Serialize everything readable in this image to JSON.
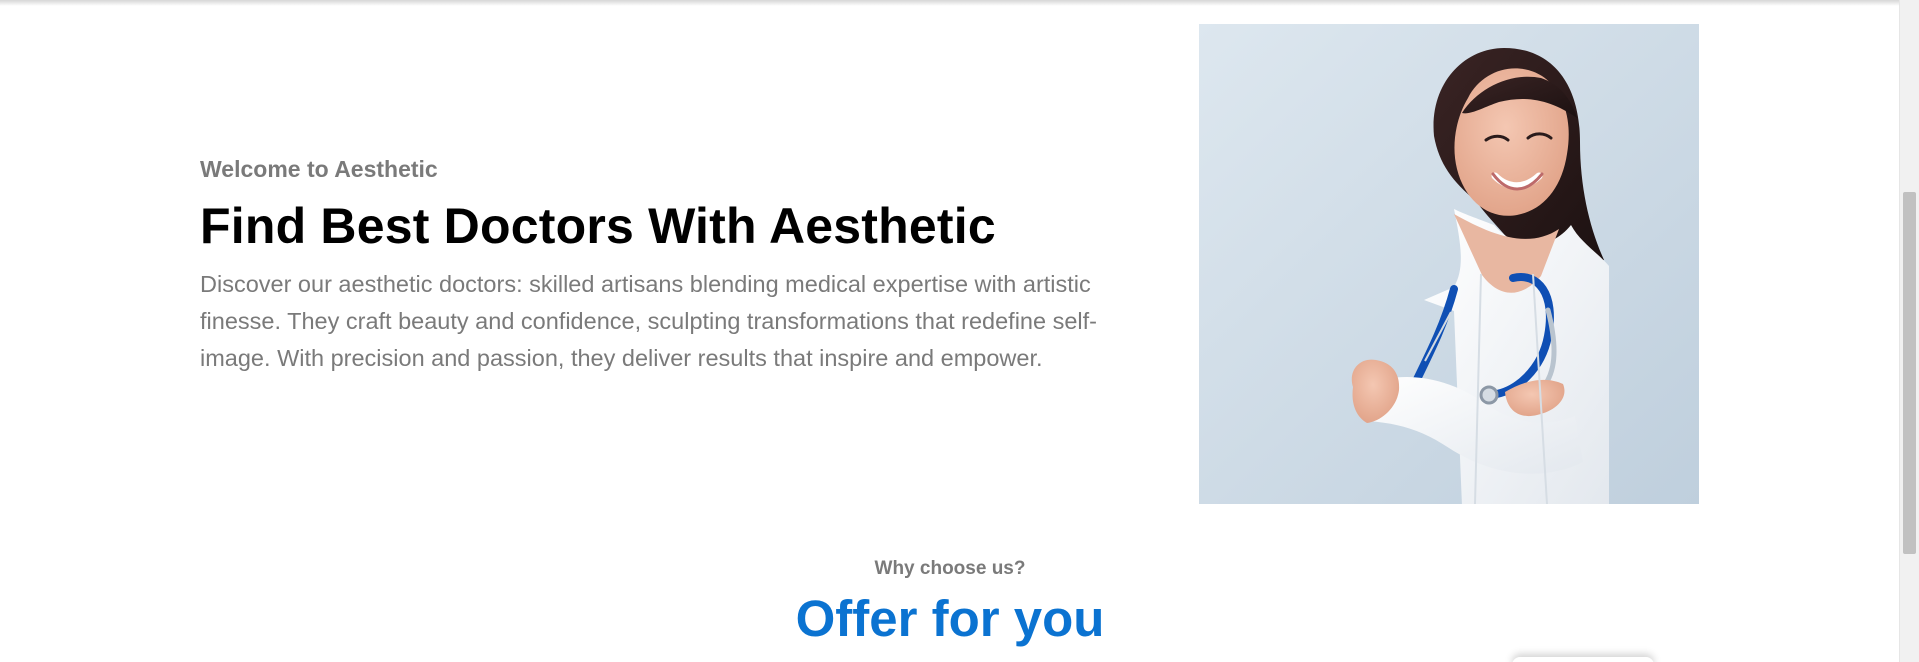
{
  "hero": {
    "eyebrow": "Welcome to Aesthetic",
    "title": "Find Best Doctors With Aesthetic",
    "description": "Discover our aesthetic doctors: skilled artisans blending medical expertise with artistic finesse. They craft beauty and confidence, sculpting transformations that redefine self-image. With precision and passion, they deliver results that inspire and empower."
  },
  "why": {
    "label": "Why choose us?",
    "title": "Offer for you"
  },
  "colors": {
    "accent": "#0b73d1",
    "muted_text": "#7a7a7a",
    "heading": "#000000",
    "image_background": "#d4e0ea"
  },
  "icons": {
    "hero_image": "doctor-photo"
  }
}
